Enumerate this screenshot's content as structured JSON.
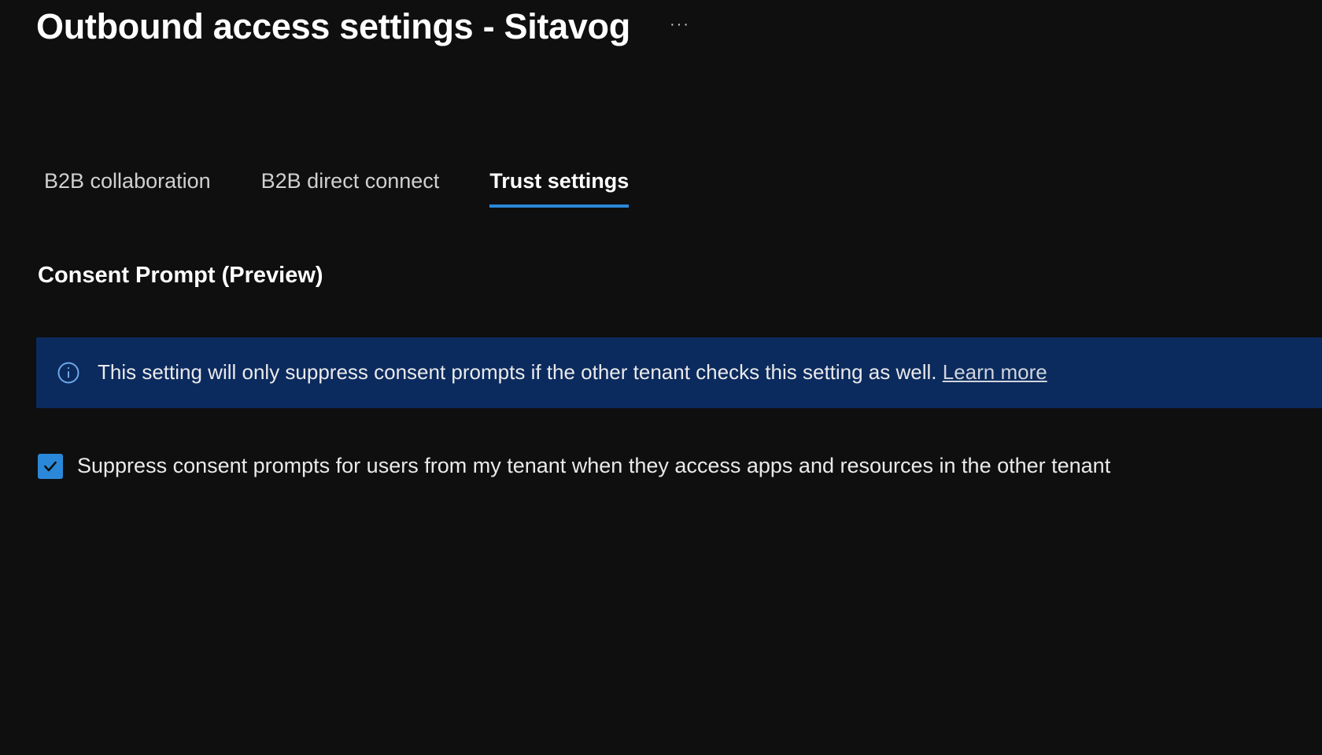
{
  "header": {
    "title": "Outbound access settings - Sitavog"
  },
  "tabs": [
    {
      "label": "B2B collaboration",
      "active": false
    },
    {
      "label": "B2B direct connect",
      "active": false
    },
    {
      "label": "Trust settings",
      "active": true
    }
  ],
  "section": {
    "heading": "Consent Prompt (Preview)"
  },
  "info": {
    "text": "This setting will only suppress consent prompts if the other tenant checks this setting as well. ",
    "learn_more": "Learn more"
  },
  "checkbox": {
    "checked": true,
    "label": "Suppress consent prompts for users from my tenant when they access apps and resources in the other tenant"
  }
}
